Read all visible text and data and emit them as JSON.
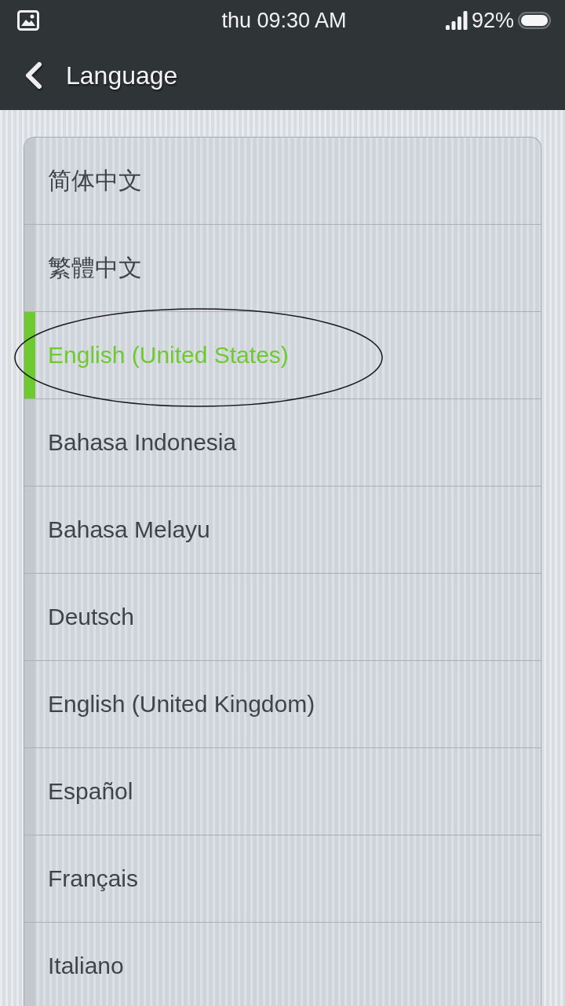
{
  "status_bar": {
    "time": "thu 09:30 AM",
    "battery": "92%"
  },
  "header": {
    "title": "Language"
  },
  "languages": [
    {
      "label": "简体中文",
      "selected": false
    },
    {
      "label": "繁體中文",
      "selected": false
    },
    {
      "label": "English (United States)",
      "selected": true
    },
    {
      "label": "Bahasa Indonesia",
      "selected": false
    },
    {
      "label": "Bahasa Melayu",
      "selected": false
    },
    {
      "label": "Deutsch",
      "selected": false
    },
    {
      "label": "English (United Kingdom)",
      "selected": false
    },
    {
      "label": "Español",
      "selected": false
    },
    {
      "label": "Français",
      "selected": false
    },
    {
      "label": "Italiano",
      "selected": false
    }
  ]
}
